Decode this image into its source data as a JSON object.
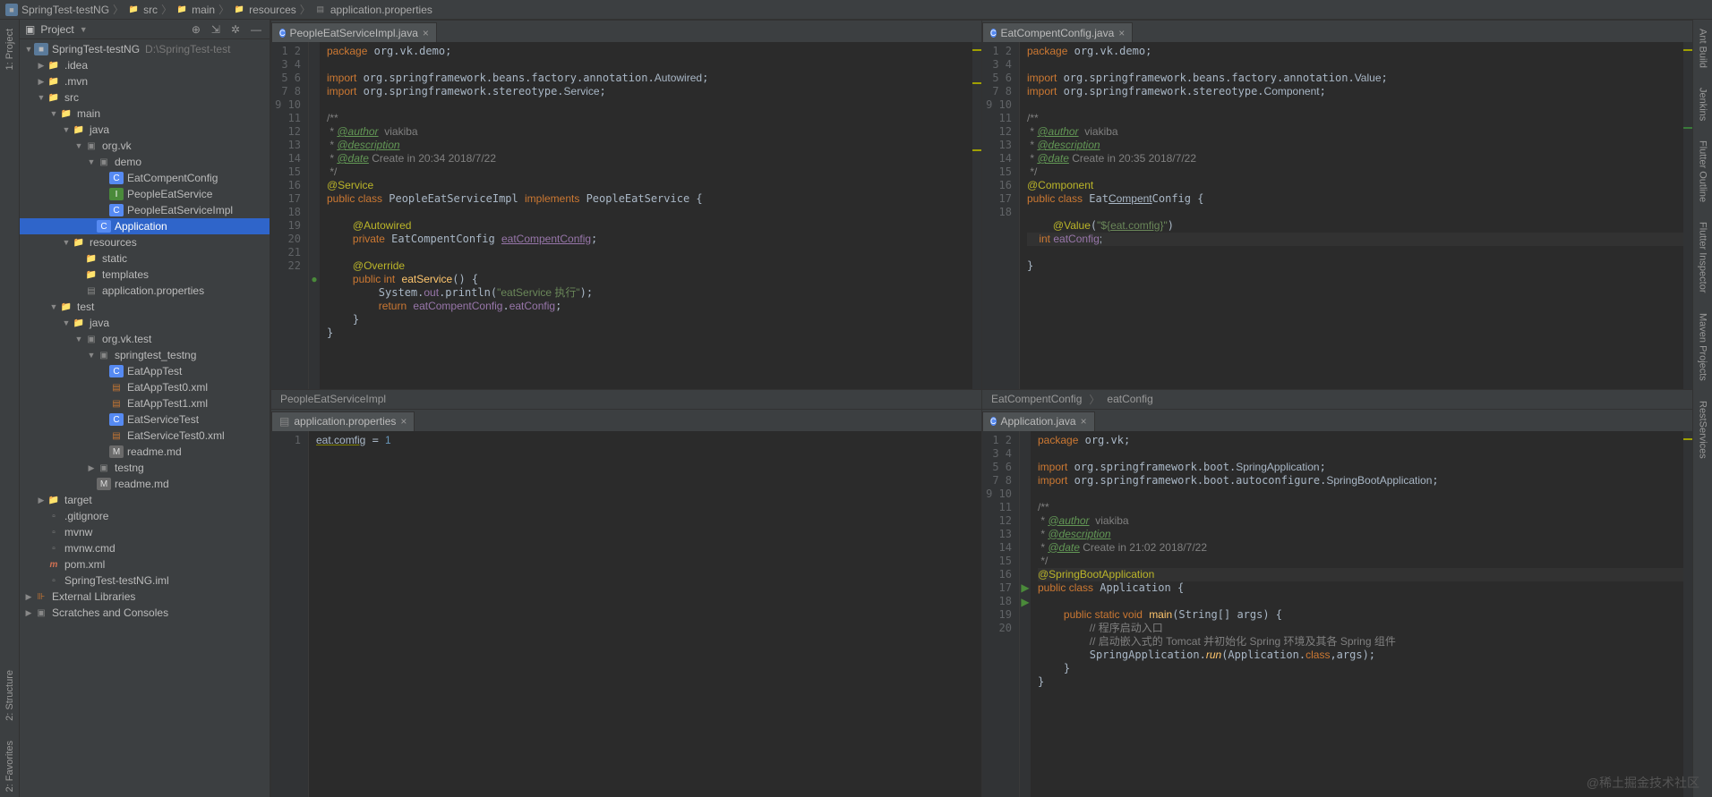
{
  "nav": {
    "items": [
      "SpringTest-testNG",
      "src",
      "main",
      "resources",
      "application.properties"
    ]
  },
  "project": {
    "label": "Project"
  },
  "left_tabs": [
    "1: Project",
    "2: Structure",
    "2: Favorites"
  ],
  "right_tabs": [
    "Ant Build",
    "Jenkins",
    "Flutter Outline",
    "Flutter Inspector",
    "Maven Projects",
    "RestServices"
  ],
  "tree": [
    {
      "d": 0,
      "a": "▼",
      "i": "mod",
      "t": "SpringTest-testNG",
      "suffix": "D:\\SpringTest-test"
    },
    {
      "d": 1,
      "a": "▶",
      "i": "fld",
      "t": ".idea"
    },
    {
      "d": 1,
      "a": "▶",
      "i": "fld",
      "t": ".mvn"
    },
    {
      "d": 1,
      "a": "▼",
      "i": "fld",
      "t": "src"
    },
    {
      "d": 2,
      "a": "▼",
      "i": "fld",
      "t": "main"
    },
    {
      "d": 3,
      "a": "▼",
      "i": "fldb",
      "t": "java"
    },
    {
      "d": 4,
      "a": "▼",
      "i": "pkg",
      "t": "org.vk"
    },
    {
      "d": 5,
      "a": "▼",
      "i": "pkg",
      "t": "demo"
    },
    {
      "d": 6,
      "a": "",
      "i": "c",
      "t": "EatCompentConfig"
    },
    {
      "d": 6,
      "a": "",
      "i": "i",
      "t": "PeopleEatService"
    },
    {
      "d": 6,
      "a": "",
      "i": "c",
      "t": "PeopleEatServiceImpl"
    },
    {
      "d": 5,
      "a": "",
      "i": "c",
      "t": "Application",
      "sel": true
    },
    {
      "d": 3,
      "a": "▼",
      "i": "fldr",
      "t": "resources"
    },
    {
      "d": 4,
      "a": "",
      "i": "fld",
      "t": "static"
    },
    {
      "d": 4,
      "a": "",
      "i": "fld",
      "t": "templates"
    },
    {
      "d": 4,
      "a": "",
      "i": "prop",
      "t": "application.properties"
    },
    {
      "d": 2,
      "a": "▼",
      "i": "fld",
      "t": "test"
    },
    {
      "d": 3,
      "a": "▼",
      "i": "fldg",
      "t": "java"
    },
    {
      "d": 4,
      "a": "▼",
      "i": "pkg",
      "t": "org.vk.test"
    },
    {
      "d": 5,
      "a": "▼",
      "i": "pkg",
      "t": "springtest_testng"
    },
    {
      "d": 6,
      "a": "",
      "i": "c",
      "t": "EatAppTest"
    },
    {
      "d": 6,
      "a": "",
      "i": "xml",
      "t": "EatAppTest0.xml"
    },
    {
      "d": 6,
      "a": "",
      "i": "xml",
      "t": "EatAppTest1.xml"
    },
    {
      "d": 6,
      "a": "",
      "i": "c",
      "t": "EatServiceTest"
    },
    {
      "d": 6,
      "a": "",
      "i": "xml",
      "t": "EatServiceTest0.xml"
    },
    {
      "d": 6,
      "a": "",
      "i": "md",
      "t": "readme.md"
    },
    {
      "d": 5,
      "a": "▶",
      "i": "pkg",
      "t": "testng"
    },
    {
      "d": 5,
      "a": "",
      "i": "md",
      "t": "readme.md"
    },
    {
      "d": 1,
      "a": "▶",
      "i": "fldo",
      "t": "target"
    },
    {
      "d": 1,
      "a": "",
      "i": "file",
      "t": ".gitignore"
    },
    {
      "d": 1,
      "a": "",
      "i": "file",
      "t": "mvnw"
    },
    {
      "d": 1,
      "a": "",
      "i": "file",
      "t": "mvnw.cmd"
    },
    {
      "d": 1,
      "a": "",
      "i": "m",
      "t": "pom.xml"
    },
    {
      "d": 1,
      "a": "",
      "i": "file",
      "t": "SpringTest-testNG.iml"
    },
    {
      "d": 0,
      "a": "▶",
      "i": "lib",
      "t": "External Libraries"
    },
    {
      "d": 0,
      "a": "▶",
      "i": "scr",
      "t": "Scratches and Consoles"
    }
  ],
  "ed1": {
    "tab": "PeopleEatServiceImpl.java",
    "crumb": "PeopleEatServiceImpl",
    "lines": 22
  },
  "ed2": {
    "tab": "EatCompentConfig.java",
    "crumb": [
      "EatCompentConfig",
      "eatConfig"
    ],
    "lines": 18
  },
  "ed3": {
    "tab": "application.properties",
    "lines": 1
  },
  "ed4": {
    "tab": "Application.java",
    "lines": 20
  },
  "watermark": "@稀土掘金技术社区"
}
